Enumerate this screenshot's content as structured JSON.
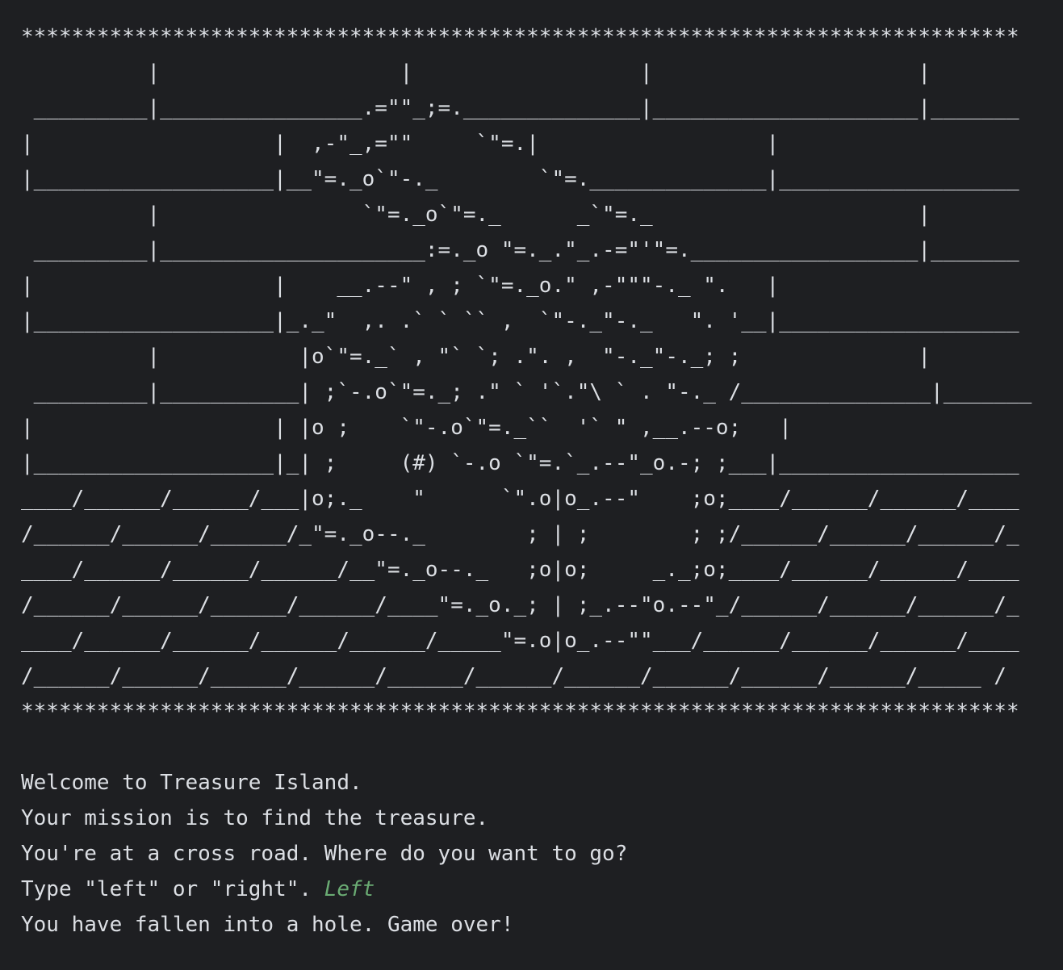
{
  "banner": {
    "lines": [
      "*******************************************************************************",
      "          |                   |                  |                     |",
      " _________|________________.=\"\"_;=.______________|_____________________|_______",
      "|                   |  ,-\"_,=\"\"     `\"=.|                  |",
      "|___________________|__\"=._o`\"-._        `\"=.______________|___________________",
      "          |                `\"=._o`\"=._      _`\"=._                     |",
      " _________|_____________________:=._o \"=._.\"_.-=\"'\"=.__________________|_______",
      "|                   |    __.--\" , ; `\"=._o.\" ,-\"\"\"-._ \".   |",
      "|___________________|_._\"  ,. .` ` `` ,  `\"-._\"-._   \". '__|___________________",
      "          |           |o`\"=._` , \"` `; .\". ,  \"-._\"-._; ;              |",
      " _________|___________| ;`-.o`\"=._; .\" ` '`.\"\\ ` . \"-._ /_______________|_______",
      "|                   | |o ;    `\"-.o`\"=._``  '` \" ,__.--o;   |",
      "|___________________|_| ;     (#) `-.o `\"=.`_.--\"_o.-; ;___|___________________",
      "____/______/______/___|o;._    \"      `\".o|o_.--\"    ;o;____/______/______/____",
      "/______/______/______/_\"=._o--._        ; | ;        ; ;/______/______/______/_",
      "____/______/______/______/__\"=._o--._   ;o|o;     _._;o;____/______/______/____",
      "/______/______/______/______/____\"=._o._; | ;_.--\"o.--\"_/______/______/______/_",
      "____/______/______/______/______/_____\"=.o|o_.--\"\"___/______/______/______/____",
      "/______/______/______/______/______/______/______/______/______/______/_____ /",
      "*******************************************************************************"
    ]
  },
  "messages": {
    "welcome": "Welcome to Treasure Island.",
    "mission": "Your mission is to find the treasure.",
    "crossroad": "You're at a cross road. Where do you want to go?",
    "prompt": "Type \"left\" or \"right\". ",
    "user_input": "Left",
    "result": "You have fallen into a hole. Game over!"
  },
  "colors": {
    "background": "#1e1f22",
    "text": "#dcdfe4",
    "input": "#6aab73"
  }
}
